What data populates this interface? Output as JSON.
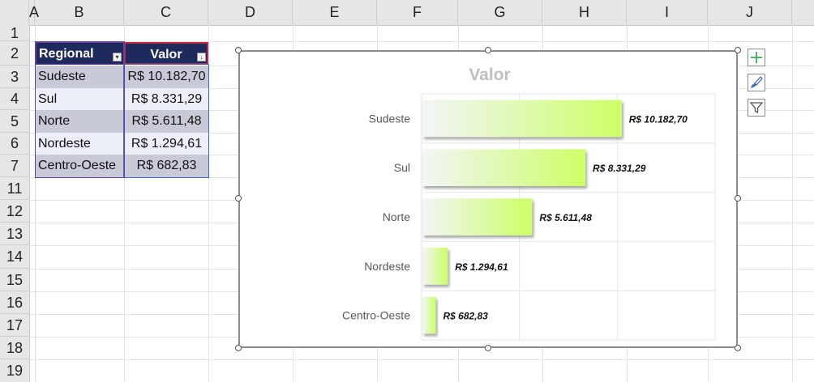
{
  "columns": [
    "A",
    "B",
    "C",
    "D",
    "E",
    "F",
    "G",
    "H",
    "I",
    "J"
  ],
  "rows": [
    "1",
    "2",
    "3",
    "4",
    "5",
    "6",
    "7",
    "11",
    "12",
    "13",
    "14",
    "15",
    "16",
    "17",
    "18",
    "19"
  ],
  "table": {
    "headers": [
      "Regional",
      "Valor"
    ],
    "rows": [
      {
        "regional": "Sudeste",
        "valor": "R$ 10.182,70"
      },
      {
        "regional": "Sul",
        "valor": "R$ 8.331,29"
      },
      {
        "regional": "Norte",
        "valor": "R$ 5.611,48"
      },
      {
        "regional": "Nordeste",
        "valor": "R$ 1.294,61"
      },
      {
        "regional": "Centro-Oeste",
        "valor": "R$ 682,83"
      }
    ]
  },
  "chart_data": {
    "type": "bar",
    "orientation": "horizontal",
    "title": "Valor",
    "categories": [
      "Sudeste",
      "Sul",
      "Norte",
      "Nordeste",
      "Centro-Oeste"
    ],
    "values": [
      10182.7,
      8331.29,
      5611.48,
      1294.61,
      682.83
    ],
    "value_labels": [
      "R$ 10.182,70",
      "R$ 8.331,29",
      "R$ 5.611,48",
      "R$ 1.294,61",
      "R$ 682,83"
    ],
    "xlim": [
      0,
      15000
    ],
    "grid": true,
    "colors": {
      "bar_start": "#f3f5f7",
      "bar_end": "#ccff66",
      "title": "#bfbfbf",
      "grid": "#e6e6e6"
    }
  },
  "chart_tools": {
    "icons": [
      "plus-icon",
      "brush-icon",
      "filter-icon"
    ],
    "colors": {
      "plus": "#2e9e48",
      "brush": "#3b6db3",
      "filter": "#555555"
    }
  },
  "colors": {
    "table_header": "#1f2a5c",
    "row_dark": "#c9cad8",
    "row_light": "#eceef8",
    "regional_border": "#6a3fa0",
    "valor_border": "#c0263a"
  }
}
